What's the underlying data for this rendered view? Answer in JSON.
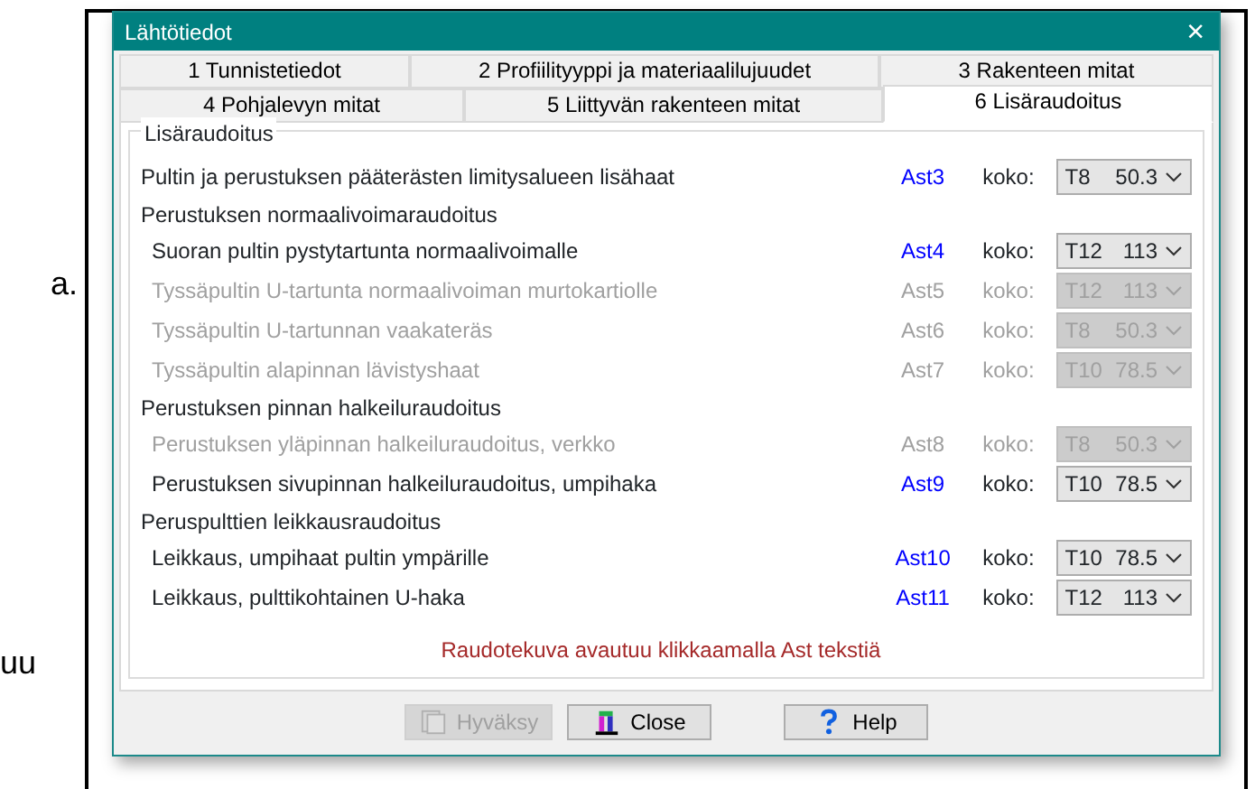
{
  "background": {
    "fragments": [
      "a.",
      "uu"
    ]
  },
  "window": {
    "title": "Lähtötiedot",
    "close": "×"
  },
  "tabs": [
    [
      {
        "label": "1 Tunnistetiedot",
        "selected": false
      },
      {
        "label": "2 Profiilityyppi ja materiaalilujuudet",
        "selected": false
      },
      {
        "label": "3 Rakenteen mitat",
        "selected": false
      }
    ],
    [
      {
        "label": "4 Pohjalevyn mitat",
        "selected": false
      },
      {
        "label": "5 Liittyvän rakenteen mitat",
        "selected": false
      },
      {
        "label": "6 Lisäraudoitus",
        "selected": true
      }
    ]
  ],
  "group": {
    "title": "Lisäraudoitus",
    "rows": [
      {
        "kind": "item",
        "label": "Pultin ja perustuksen pääterästen limitysalueen lisähaat",
        "ast": "Ast3",
        "size_label": "koko:",
        "bar": "T8",
        "area": "50.3",
        "disabled": false
      },
      {
        "kind": "heading",
        "label": "Perustuksen normaalivoimaraudoitus",
        "children": [
          {
            "kind": "item",
            "label": "Suoran pultin pystytartunta normaalivoimalle",
            "ast": "Ast4",
            "size_label": "koko:",
            "bar": "T12",
            "area": "113",
            "disabled": false
          },
          {
            "kind": "item",
            "label": "Tyssäpultin U-tartunta normaalivoiman murtokartiolle",
            "ast": "Ast5",
            "size_label": "koko:",
            "bar": "T12",
            "area": "113",
            "disabled": true
          },
          {
            "kind": "item",
            "label": "Tyssäpultin U-tartunnan vaakateräs",
            "ast": "Ast6",
            "size_label": "koko:",
            "bar": "T8",
            "area": "50.3",
            "disabled": true
          },
          {
            "kind": "item",
            "label": "Tyssäpultin alapinnan lävistyshaat",
            "ast": "Ast7",
            "size_label": "koko:",
            "bar": "T10",
            "area": "78.5",
            "disabled": true
          }
        ]
      },
      {
        "kind": "heading",
        "label": "Perustuksen pinnan halkeiluraudoitus",
        "children": [
          {
            "kind": "item",
            "label": "Perustuksen yläpinnan halkeiluraudoitus, verkko",
            "ast": "Ast8",
            "size_label": "koko:",
            "bar": "T8",
            "area": "50.3",
            "disabled": true
          },
          {
            "kind": "item",
            "label": "Perustuksen sivupinnan halkeiluraudoitus, umpihaka",
            "ast": "Ast9",
            "size_label": "koko:",
            "bar": "T10",
            "area": "78.5",
            "disabled": false
          }
        ]
      },
      {
        "kind": "heading",
        "label": "Peruspulttien leikkausraudoitus",
        "children": [
          {
            "kind": "item",
            "label": "Leikkaus, umpihaat pultin ympärille",
            "ast": "Ast10",
            "size_label": "koko:",
            "bar": "T10",
            "area": "78.5",
            "disabled": false
          },
          {
            "kind": "item",
            "label": "Leikkaus, pulttikohtainen U-haka",
            "ast": "Ast11",
            "size_label": "koko:",
            "bar": "T12",
            "area": "113",
            "disabled": false
          }
        ]
      }
    ],
    "note": "Raudotekuva avautuu klikkaamalla Ast tekstiä"
  },
  "buttons": [
    {
      "kind": "accept",
      "label": "Hyväksy",
      "disabled": true
    },
    {
      "kind": "close",
      "label": "Close",
      "disabled": false
    },
    {
      "kind": "help",
      "label": "Help",
      "disabled": false
    }
  ]
}
